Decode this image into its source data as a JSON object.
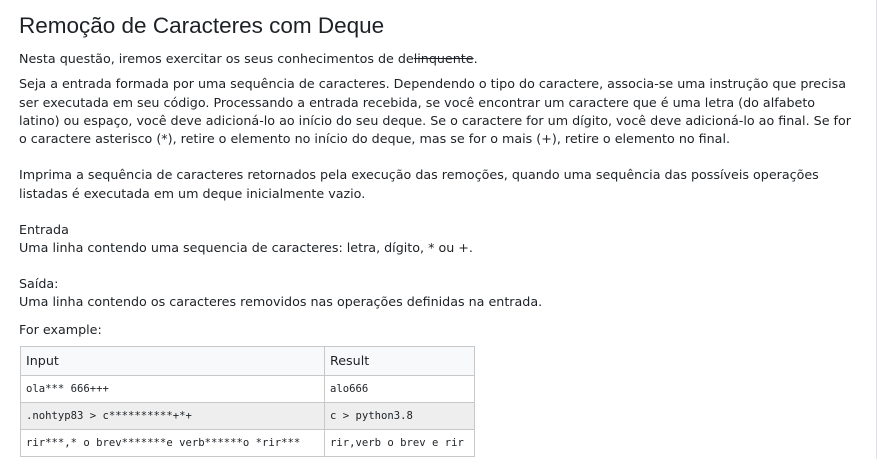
{
  "question": {
    "title": "Remoção de Caracteres com Deque",
    "intro_prefix": "Nesta questão, iremos exercitar os seus conhecimentos de de",
    "intro_struck": "linquente",
    "intro_suffix": ".",
    "paragraph1": "Seja a entrada formada por uma sequência de caracteres. Dependendo o tipo do caractere, associa-se uma instrução que precisa ser executada em seu código. Processando a entrada recebida, se você encontrar um caractere que é uma letra (do alfabeto latino) ou espaço, você deve adicioná-lo ao início do seu deque. Se o caractere for um dígito, você deve adicioná-lo ao final. Se for o caractere asterisco (*), retire o elemento no início do deque, mas se for o mais (+), retire o elemento no final.",
    "paragraph2": "Imprima a sequência de caracteres retornados pela execução das remoções, quando uma sequência das possíveis operações listadas é executada em um deque inicialmente vazio.",
    "input_heading": "Entrada",
    "input_description": "Uma linha contendo uma sequencia de caracteres: letra, dígito, * ou +.",
    "output_heading": "Saída:",
    "output_description": "Uma linha contendo os caracteres removidos nas operações definidas  na entrada.",
    "example_label": "For example:"
  },
  "examples": {
    "headers": [
      "Input",
      "Result"
    ],
    "rows": [
      {
        "input": "ola*** 666+++",
        "result": "alo666"
      },
      {
        "input": ".nohtyp83 > c**********+*+",
        "result": "c > python3.8"
      },
      {
        "input": "rir***,* o brev*******e verb******o *rir***",
        "result": "rir,verb o brev e rir"
      }
    ]
  }
}
